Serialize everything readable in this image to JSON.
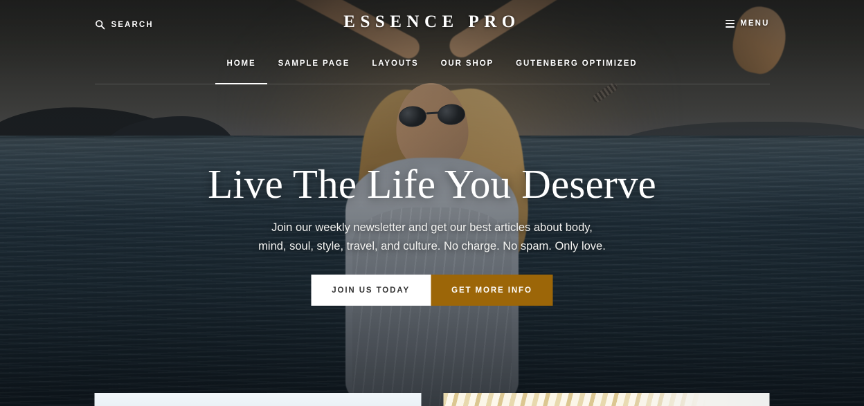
{
  "site": {
    "logo": "Essence Pro"
  },
  "header": {
    "search": {
      "label": "Search",
      "icon": "search-icon"
    },
    "menu": {
      "label": "Menu",
      "icon": "hamburger-icon"
    },
    "nav": [
      {
        "label": "Home",
        "current": true
      },
      {
        "label": "Sample Page",
        "current": false
      },
      {
        "label": "Layouts",
        "current": false
      },
      {
        "label": "Our Shop",
        "current": false
      },
      {
        "label": "Gutenberg Optimized",
        "current": false
      }
    ]
  },
  "hero": {
    "title": "Live The Life You Deserve",
    "subtitle": "Join our weekly newsletter and get our best articles about body, mind, soul, style, travel, and culture. No charge. No spam. Only love.",
    "primary_button": "Join Us Today",
    "secondary_button": "Get More Info"
  },
  "colors": {
    "accent": "#9c6608",
    "button_text_dark": "#333333",
    "button_bg_light": "#ffffff",
    "text_light": "#ffffff",
    "nav_divider": "rgba(255,255,255,0.16)"
  }
}
